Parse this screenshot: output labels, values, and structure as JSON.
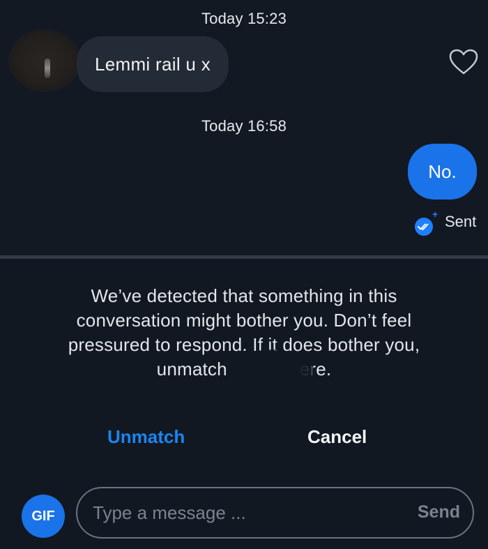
{
  "chat": {
    "timestamp_1": "Today 15:23",
    "incoming_message": "Lemmi rail u x",
    "timestamp_2": "Today 16:58",
    "outgoing_message": "No.",
    "delivery_status": "Sent",
    "accent_color": "#1a73e8"
  },
  "safety_notice": {
    "line_1": "We’ve detected that something in this",
    "line_2": "conversation might bother you. Don’t feel",
    "line_3": "pressured to respond. If it does bother you,",
    "line_4": "unmatch              ere."
  },
  "actions": {
    "unmatch_label": "Unmatch",
    "cancel_label": "Cancel"
  },
  "composer": {
    "gif_label": "GIF",
    "placeholder": "Type a message ...",
    "send_label": "Send"
  },
  "icons": [
    "heart-icon",
    "double-check-icon",
    "plus-icon"
  ]
}
